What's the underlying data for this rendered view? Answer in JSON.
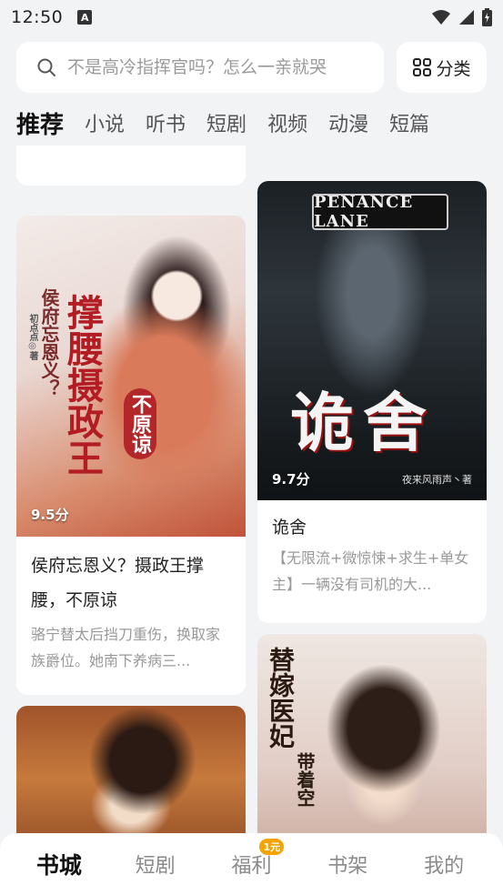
{
  "status_bar": {
    "time": "12:50",
    "app_icon_letter": "A"
  },
  "search": {
    "placeholder": "不是高冷指挥官吗？怎么一亲就哭",
    "category_label": "分类"
  },
  "tabs": [
    {
      "label": "推荐",
      "active": true
    },
    {
      "label": "小说"
    },
    {
      "label": "听书"
    },
    {
      "label": "短剧"
    },
    {
      "label": "视频"
    },
    {
      "label": "动漫"
    },
    {
      "label": "短篇"
    }
  ],
  "books": [
    {
      "cover_title": "撑腰摄政王",
      "cover_subtitle": "侯府忘恩义？",
      "cover_tag": "不原谅",
      "cover_author": "初点点◎著",
      "rating": "9.5分",
      "title": "侯府忘恩义？摄政王撑腰，不原谅",
      "desc": "骆宁替太后挡刀重伤，换取家族爵位。她南下养病三..."
    },
    {
      "cover_sign": "PENANCE LANE",
      "cover_title": "诡舍",
      "cover_author": "夜来风雨声丶著",
      "rating": "9.7分",
      "title": "诡舍",
      "desc": "【无限流+微惊悚+求生+单女主】一辆没有司机的大..."
    },
    {
      "cover_title": "替嫁医妃",
      "cover_subtitle": "带着空"
    }
  ],
  "bottom_nav": [
    {
      "label": "书城",
      "active": true
    },
    {
      "label": "短剧"
    },
    {
      "label": "福利",
      "badge": "1元"
    },
    {
      "label": "书架"
    },
    {
      "label": "我的"
    }
  ]
}
